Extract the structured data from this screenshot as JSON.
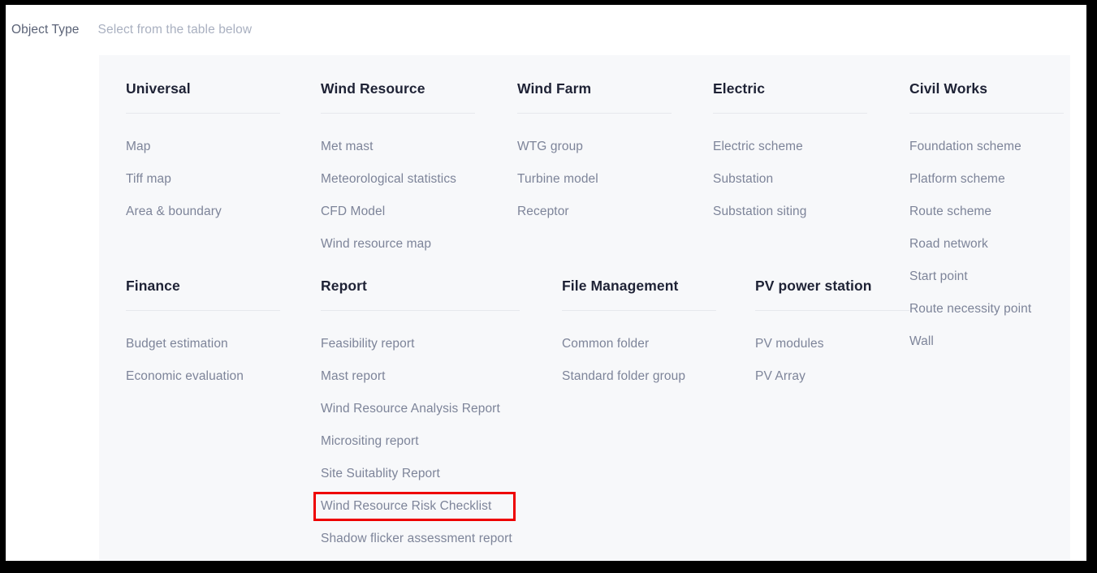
{
  "header": {
    "label": "Object Type",
    "hint": "Select from the table below"
  },
  "highlight_color": "#ee0000",
  "panel": {
    "background": "#f7f8fa",
    "title_color": "#1e2235",
    "item_color": "#7d8499",
    "rule_color": "#e6e8ed"
  },
  "columns": [
    {
      "title": "Universal",
      "items": [
        {
          "label": "Map",
          "highlighted": false
        },
        {
          "label": "Tiff map",
          "highlighted": false
        },
        {
          "label": "Area & boundary",
          "highlighted": false
        }
      ]
    },
    {
      "title": "Wind Resource",
      "items": [
        {
          "label": "Met mast",
          "highlighted": false
        },
        {
          "label": "Meteorological statistics",
          "highlighted": false
        },
        {
          "label": "CFD Model",
          "highlighted": false
        },
        {
          "label": "Wind resource map",
          "highlighted": false
        }
      ]
    },
    {
      "title": "Wind Farm",
      "items": [
        {
          "label": "WTG group",
          "highlighted": false
        },
        {
          "label": "Turbine model",
          "highlighted": false
        },
        {
          "label": "Receptor",
          "highlighted": false
        }
      ]
    },
    {
      "title": "Electric",
      "items": [
        {
          "label": "Electric scheme",
          "highlighted": false
        },
        {
          "label": "Substation",
          "highlighted": false
        },
        {
          "label": "Substation siting",
          "highlighted": false
        }
      ]
    },
    {
      "title": "Civil Works",
      "items": [
        {
          "label": "Foundation scheme",
          "highlighted": false
        },
        {
          "label": "Platform scheme",
          "highlighted": false
        },
        {
          "label": "Route scheme",
          "highlighted": false
        },
        {
          "label": "Road network",
          "highlighted": false
        },
        {
          "label": "Start point",
          "highlighted": false
        },
        {
          "label": "Route necessity point",
          "highlighted": false
        },
        {
          "label": "Wall",
          "highlighted": false
        }
      ]
    },
    {
      "title": "Finance",
      "items": [
        {
          "label": "Budget estimation",
          "highlighted": false
        },
        {
          "label": "Economic evaluation",
          "highlighted": false
        }
      ]
    },
    {
      "title": "Report",
      "items": [
        {
          "label": "Feasibility report",
          "highlighted": false
        },
        {
          "label": "Mast report",
          "highlighted": false
        },
        {
          "label": "Wind Resource Analysis Report",
          "highlighted": false
        },
        {
          "label": "Micrositing report",
          "highlighted": false
        },
        {
          "label": "Site Suitablity Report",
          "highlighted": false
        },
        {
          "label": "Wind Resource Risk Checklist",
          "highlighted": true
        },
        {
          "label": "Shadow flicker assessment report",
          "highlighted": false
        }
      ]
    },
    {
      "title": "File Management",
      "items": [
        {
          "label": "Common folder",
          "highlighted": false
        },
        {
          "label": "Standard folder group",
          "highlighted": false
        }
      ]
    },
    {
      "title": "PV power station",
      "items": [
        {
          "label": "PV modules",
          "highlighted": false
        },
        {
          "label": "PV Array",
          "highlighted": false
        }
      ]
    }
  ]
}
